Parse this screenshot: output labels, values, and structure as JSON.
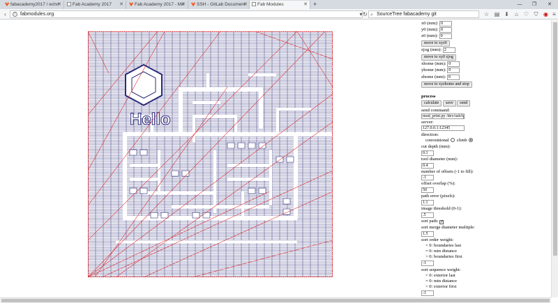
{
  "browser": {
    "tabs": [
      {
        "title": "fabacademy2017 / echofe...",
        "icon": "gitlab-icon"
      },
      {
        "title": "Fab Academy 2017",
        "icon": "page-icon"
      },
      {
        "title": "Fab Academy 2017 - Mikko To...",
        "icon": "gitlab-icon"
      },
      {
        "title": "SSH - GitLab Documentati...",
        "icon": "gitlab-icon"
      },
      {
        "title": "Fab Modules",
        "icon": "page-icon"
      }
    ],
    "url": "fabmodules.org",
    "search_value": "SourceTree fabacademy git"
  },
  "colors": {
    "toolpath_blue": "#2b2b7a",
    "rapid_red": "#e0201e"
  },
  "panel": {
    "x0_label": "x0 (mm):",
    "x0_value": "0",
    "y0_label": "y0 (mm):",
    "y0_value": "0",
    "z0_label": "z0 (mm):",
    "z0_value": "0",
    "move_xyz0": "move to xyz0",
    "zjog_label": "zjog (mm):",
    "zjog_value": "2",
    "move_xy0_zjog": "move to xy0 zjog",
    "xhome_label": "xhome (mm):",
    "xhome_value": "0",
    "yhome_label": "yhome (mm):",
    "yhome_value": "0",
    "zhome_label": "zhome (mm):",
    "zhome_value": "0",
    "move_home": "move to xyzhome and stop",
    "process_title": "process",
    "calculate": "calculate",
    "save": "save",
    "send": "send",
    "send_command_label": "send command:",
    "send_command_value": "mod_print.py /dev/usb/lp",
    "server_label": "server:",
    "server_value": "127.0.0.1:12345",
    "direction_label": "direction:",
    "direction_conventional": "conventional",
    "direction_climb": "climb",
    "cut_depth_label": "cut depth (mm):",
    "cut_depth_value": "0.1",
    "tool_diameter_label": "tool diameter (mm):",
    "tool_diameter_value": "0.4",
    "offsets_label": "number of offsets (-1 to fill):",
    "offsets_value": "-1",
    "overlap_label": "offset overlap (%):",
    "overlap_value": "50",
    "path_error_label": "path error (pixels):",
    "path_error_value": "1.1",
    "threshold_label": "image threshold (0-1):",
    "threshold_value": ".5",
    "sort_path_label": "sort path:",
    "merge_label": "sort merge diameter multiple:",
    "merge_value": "1.5",
    "order_weight_label": "sort order weight:",
    "order_line1": "< 0: boundaries last",
    "order_line2": "= 0: min distance",
    "order_line3": "> 0: boundaries first",
    "order_value": "-1",
    "sequence_weight_label": "sort sequence weight:",
    "seq_line1": "< 0: exterior last",
    "seq_line2": "= 0: min distance",
    "seq_line3": "> 0: exterior first",
    "seq_value": "-1"
  },
  "board": {
    "text": "Hello"
  }
}
